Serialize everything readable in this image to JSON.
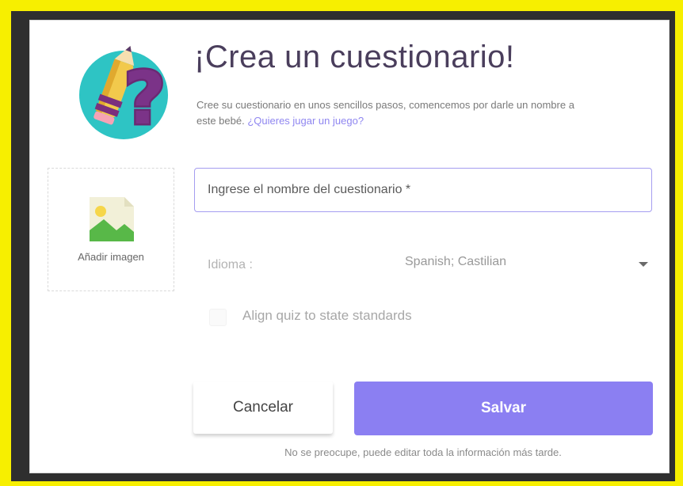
{
  "dialog": {
    "title": "¡Crea un cuestionario!",
    "subtitle_text": "Cree su cuestionario en unos sencillos pasos, comencemos por darle un nombre a este bebé.",
    "subtitle_link": "¿Quieres jugar un juego?"
  },
  "image_upload": {
    "label": "Añadir imagen",
    "icon": "image-placeholder-icon"
  },
  "quiz_name": {
    "value": "",
    "placeholder": "Ingrese el nombre del cuestionario *"
  },
  "language": {
    "label": "Idioma :",
    "selected": "Spanish; Castilian",
    "icon": "caret-down-icon"
  },
  "standards": {
    "label": "Align quiz to state standards",
    "checked": false
  },
  "actions": {
    "cancel_label": "Cancelar",
    "save_label": "Salvar"
  },
  "footer": {
    "note": "No se preocupe, puede editar toda la información más tarde."
  },
  "colors": {
    "accent": "#8b7ff2",
    "input_border": "#a59df0",
    "frame_highlight": "#f7ef00",
    "title_text": "#4a3e5c"
  }
}
